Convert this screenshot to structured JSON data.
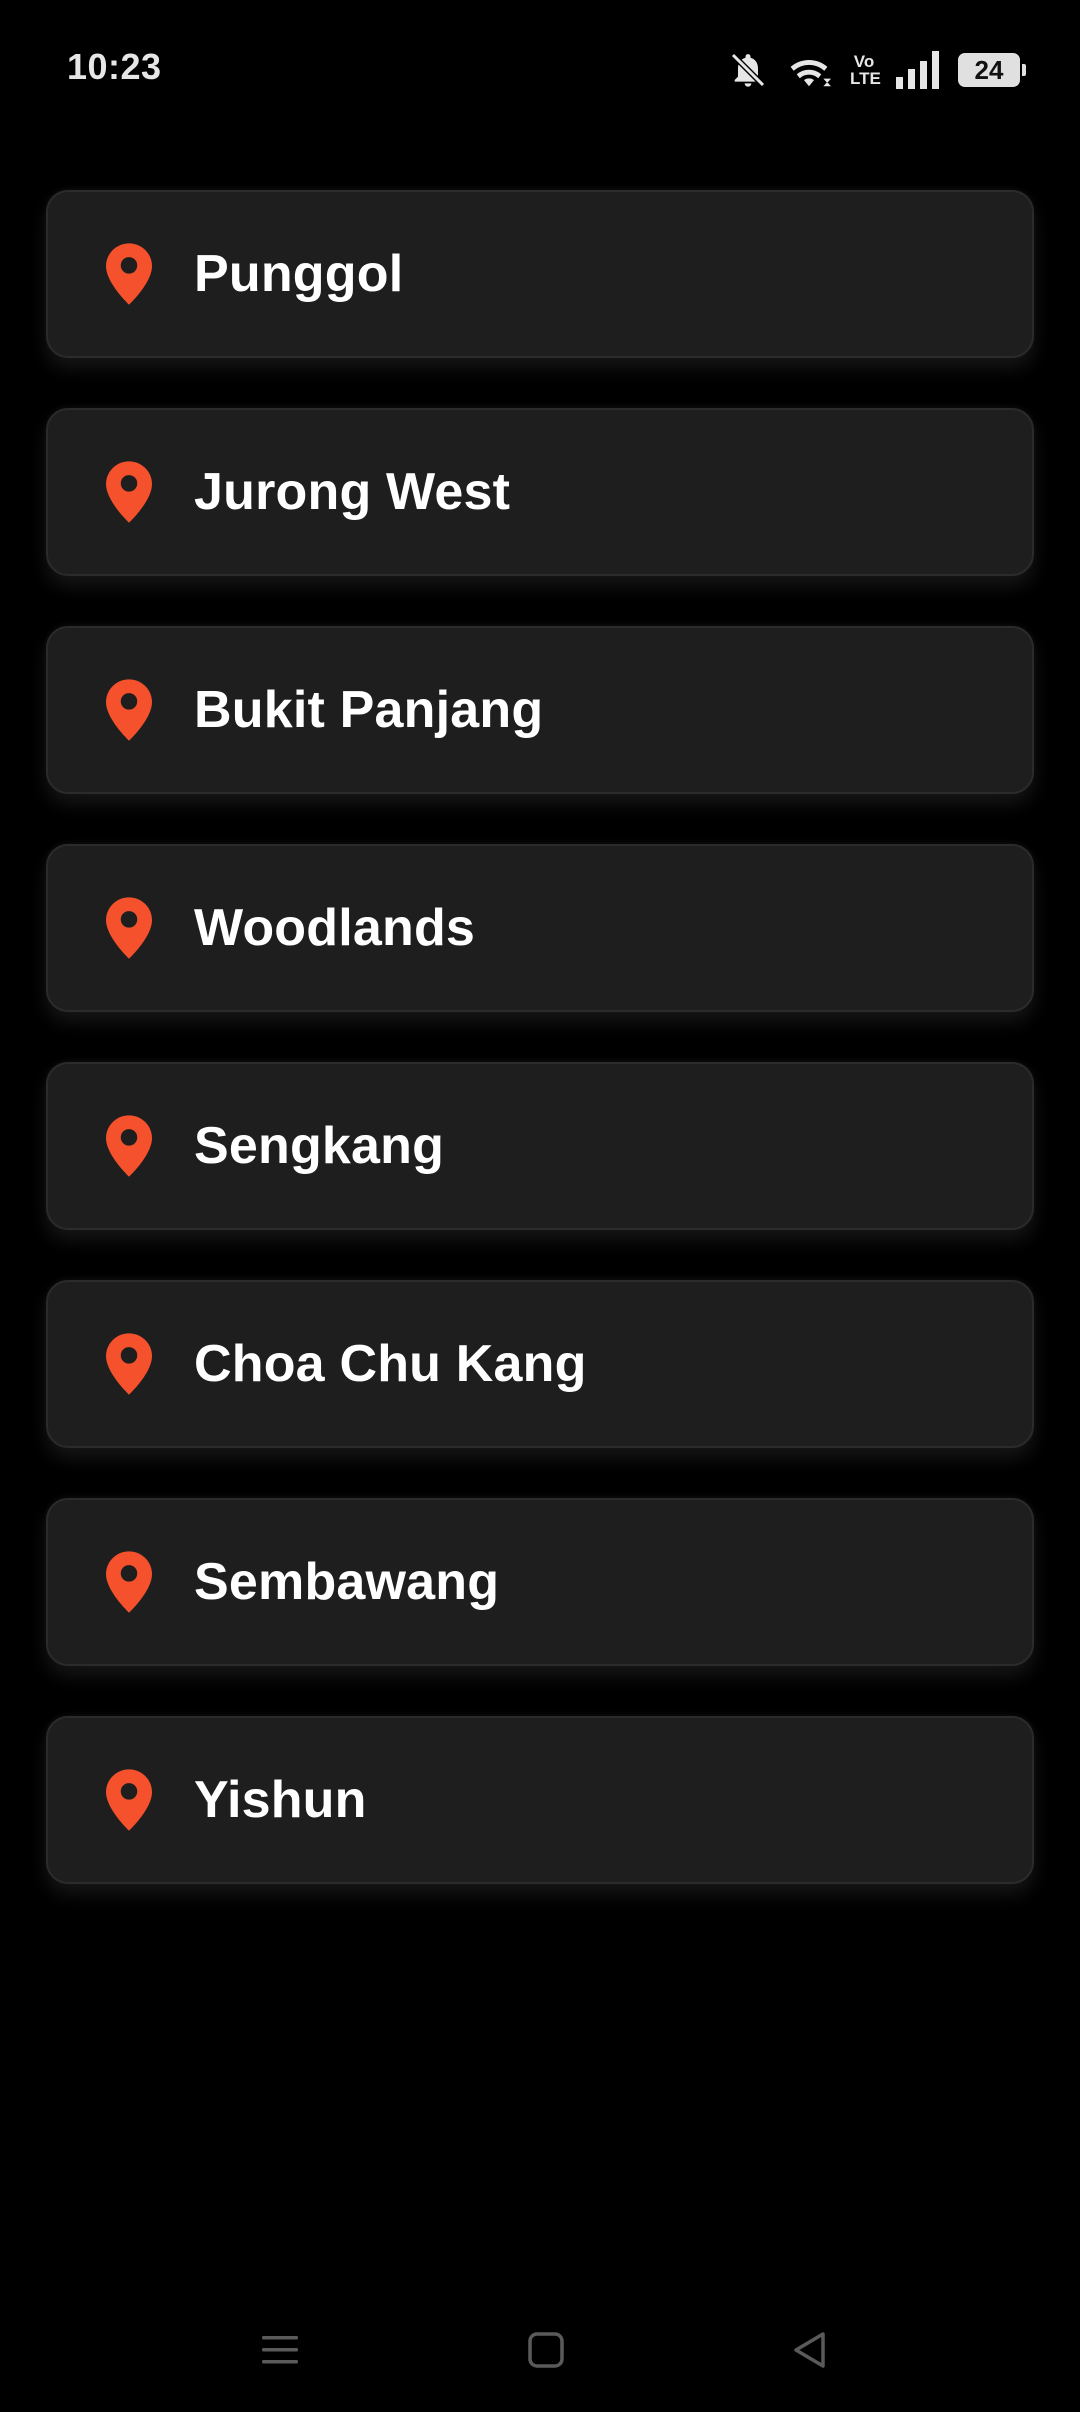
{
  "status_bar": {
    "time": "10:23",
    "volte_top": "Vo",
    "volte_bottom": "LTE",
    "battery_level": "24",
    "icons": [
      "notifications-off-icon",
      "wifi-icon",
      "volte-icon",
      "signal-icon",
      "battery-icon"
    ]
  },
  "locations": [
    {
      "name": "Punggol",
      "icon": "location-pin-icon"
    },
    {
      "name": "Jurong West",
      "icon": "location-pin-icon"
    },
    {
      "name": "Bukit Panjang",
      "icon": "location-pin-icon"
    },
    {
      "name": "Woodlands",
      "icon": "location-pin-icon"
    },
    {
      "name": "Sengkang",
      "icon": "location-pin-icon"
    },
    {
      "name": "Choa Chu Kang",
      "icon": "location-pin-icon"
    },
    {
      "name": "Sembawang",
      "icon": "location-pin-icon"
    },
    {
      "name": "Yishun",
      "icon": "location-pin-icon"
    }
  ],
  "nav_bar": {
    "buttons": [
      "menu-icon",
      "home-icon",
      "back-icon"
    ]
  },
  "colors": {
    "background": "#000000",
    "card": "#1e1e1f",
    "accent_pin": "#f4512c",
    "text": "#ffffff"
  }
}
